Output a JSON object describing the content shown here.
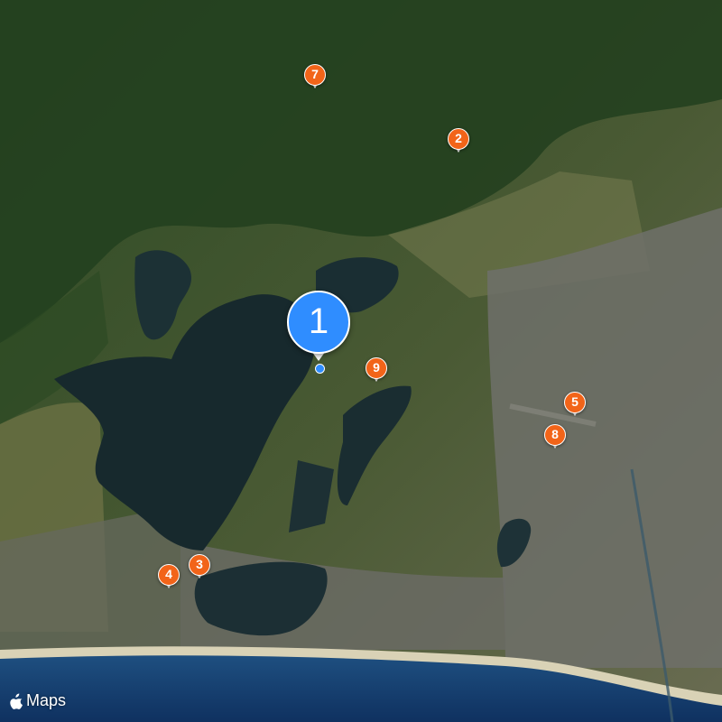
{
  "map": {
    "style": "satellite",
    "colors": {
      "forest": "#2c4a24",
      "farmland": "#6f7346",
      "urban": "#6e706a",
      "bay": "#17292d",
      "sea": "#123a66",
      "beach": "#d9d2b6",
      "pin_orange": "#f26419",
      "pin_blue": "#2f8dff"
    }
  },
  "markers": [
    {
      "id": "1",
      "label": "1",
      "selected": true
    },
    {
      "id": "2",
      "label": "2"
    },
    {
      "id": "3",
      "label": "3"
    },
    {
      "id": "4",
      "label": "4"
    },
    {
      "id": "5",
      "label": "5"
    },
    {
      "id": "7",
      "label": "7"
    },
    {
      "id": "8",
      "label": "8"
    },
    {
      "id": "9",
      "label": "9"
    }
  ],
  "attribution": {
    "icon": "apple-logo-icon",
    "text": "Maps"
  }
}
